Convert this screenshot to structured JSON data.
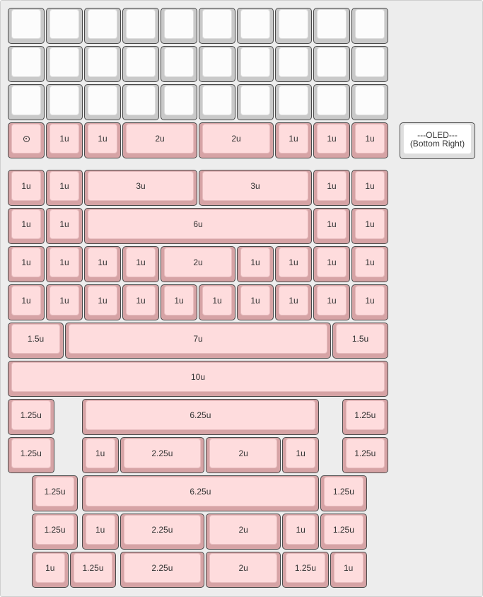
{
  "rotary_symbol": "rotary-encoder-icon",
  "oled": {
    "line1": "---OLED---",
    "line2": "(Bottom Right)"
  },
  "rows": [
    [
      "",
      "",
      "",
      "",
      "",
      "",
      "",
      "",
      "",
      ""
    ],
    [
      "",
      "",
      "",
      "",
      "",
      "",
      "",
      "",
      "",
      ""
    ],
    [
      "",
      "",
      "",
      "",
      "",
      "",
      "",
      "",
      "",
      ""
    ],
    [
      "",
      "1u",
      "1u",
      "2u",
      "2u",
      "1u",
      "1u",
      "1u"
    ],
    [
      "1u",
      "1u",
      "3u",
      "3u",
      "1u",
      "1u"
    ],
    [
      "1u",
      "1u",
      "6u",
      "1u",
      "1u"
    ],
    [
      "1u",
      "1u",
      "1u",
      "1u",
      "2u",
      "1u",
      "1u",
      "1u",
      "1u"
    ],
    [
      "1u",
      "1u",
      "1u",
      "1u",
      "1u",
      "1u",
      "1u",
      "1u",
      "1u",
      "1u"
    ],
    [
      "1.5u",
      "7u",
      "1.5u"
    ],
    [
      "10u"
    ],
    [
      "1.25u",
      "6.25u",
      "1.25u"
    ],
    [
      "1.25u",
      "1u",
      "2.25u",
      "2u",
      "1u",
      "1.25u"
    ],
    [
      "1.25u",
      "6.25u",
      "1.25u"
    ],
    [
      "1.25u",
      "1u",
      "2.25u",
      "2u",
      "1u",
      "1.25u"
    ],
    [
      "1u",
      "1.25u",
      "2.25u",
      "2u",
      "1.25u",
      "1u"
    ]
  ]
}
